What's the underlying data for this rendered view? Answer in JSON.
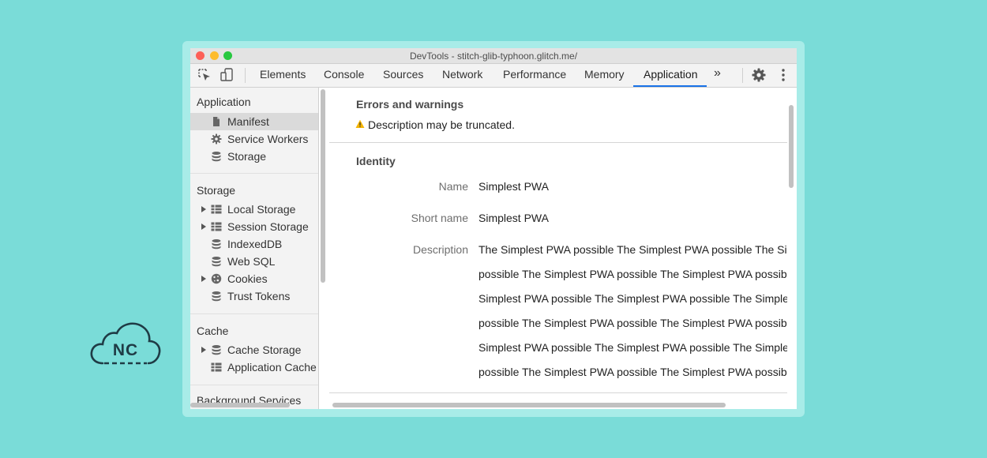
{
  "window": {
    "title": "DevTools - stitch-glib-typhoon.glitch.me/",
    "traffic_lights": {
      "close": "#fd5f57",
      "minimize": "#fdbc2e",
      "zoom": "#28c840"
    }
  },
  "toolbar": {
    "tabs": [
      "Elements",
      "Console",
      "Sources",
      "Network",
      "Performance",
      "Memory",
      "Application"
    ],
    "active_tab": "Application",
    "more_label": "»",
    "accent": "#1a73e8"
  },
  "sidebar": {
    "application_header": "Application",
    "application_items": [
      {
        "label": "Manifest",
        "icon": "document-icon",
        "selected": true
      },
      {
        "label": "Service Workers",
        "icon": "gear-icon"
      },
      {
        "label": "Storage",
        "icon": "database-icon"
      }
    ],
    "storage_header": "Storage",
    "storage_items": [
      {
        "label": "Local Storage",
        "icon": "grid-icon",
        "expandable": true
      },
      {
        "label": "Session Storage",
        "icon": "grid-icon",
        "expandable": true
      },
      {
        "label": "IndexedDB",
        "icon": "database-icon"
      },
      {
        "label": "Web SQL",
        "icon": "database-icon"
      },
      {
        "label": "Cookies",
        "icon": "cookie-icon",
        "expandable": true
      },
      {
        "label": "Trust Tokens",
        "icon": "database-icon"
      }
    ],
    "cache_header": "Cache",
    "cache_items": [
      {
        "label": "Cache Storage",
        "icon": "database-icon",
        "expandable": true
      },
      {
        "label": "Application Cache",
        "icon": "grid-icon"
      }
    ],
    "background_header": "Background Services"
  },
  "main": {
    "errors_title": "Errors and warnings",
    "warning_text": "Description may be truncated.",
    "identity_title": "Identity",
    "name_label": "Name",
    "name_value": "Simplest PWA",
    "short_name_label": "Short name",
    "short_name_value": "Simplest PWA",
    "description_label": "Description",
    "description_lines": [
      "The Simplest PWA possible The Simplest PWA possible The Simplest PWA",
      "possible The Simplest PWA possible The Simplest PWA possible The",
      "Simplest PWA possible The Simplest PWA possible The Simplest PWA",
      "possible The Simplest PWA possible The Simplest PWA possible The",
      "Simplest PWA possible The Simplest PWA possible The Simplest PWA",
      "possible The Simplest PWA possible The Simplest PWA possible"
    ]
  },
  "logo": {
    "text": "NC",
    "color": "#1f3b45"
  }
}
